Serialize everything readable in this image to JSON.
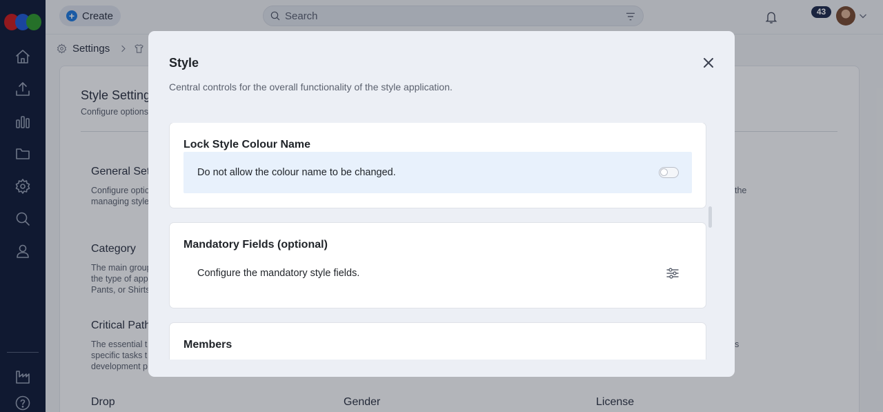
{
  "topbar": {
    "create_label": "Create",
    "search_placeholder": "Search",
    "notification_count": "43"
  },
  "breadcrumb": {
    "items": [
      "Settings"
    ]
  },
  "background_page": {
    "title": "Style Setting",
    "subtitle": "Configure options",
    "sections": [
      {
        "title": "General Set",
        "desc_line1": "Configure optio",
        "desc_line2": "managing style"
      },
      {
        "title": "Category",
        "desc_line1": "The main group",
        "desc_line2": "the type of app",
        "desc_line3": "Pants, or Shirts"
      },
      {
        "title": "Critical Path",
        "desc_line1": "The essential t",
        "desc_line2": "specific tasks t",
        "desc_line3": "development p"
      },
      {
        "title": "Drop"
      },
      {
        "title": "Gender"
      },
      {
        "title": "License"
      }
    ],
    "right_fragments": [
      "the",
      "s"
    ]
  },
  "modal": {
    "title": "Style",
    "description": "Central controls for the overall functionality of the style application.",
    "sections": [
      {
        "title": "Lock Style Colour Name",
        "row_text": "Do not allow the colour name to be changed.",
        "toggle_on": false
      },
      {
        "title": "Mandatory Fields (optional)",
        "row_text": "Configure the mandatory style fields."
      },
      {
        "title": "Members"
      }
    ]
  }
}
